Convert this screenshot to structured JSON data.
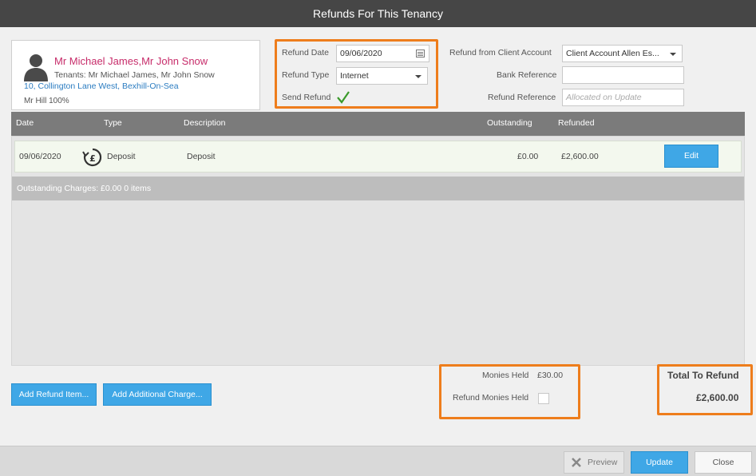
{
  "window": {
    "title": "Refunds For This Tenancy"
  },
  "tenant": {
    "name": "Mr Michael James,Mr John Snow",
    "tenants_line": "Tenants: Mr Michael James, Mr John Snow",
    "address": "10, Collington Lane West, Bexhill-On-Sea",
    "landlord": "Mr Hill 100%"
  },
  "refund_form": {
    "refund_date_label": "Refund Date",
    "refund_date_value": "09/06/2020",
    "refund_type_label": "Refund Type",
    "refund_type_value": "Internet",
    "send_refund_label": "Send Refund",
    "send_refund_checked": true,
    "client_account_label": "Refund from Client Account",
    "client_account_value": "Client Account Allen Es...",
    "bank_reference_label": "Bank Reference",
    "bank_reference_value": "",
    "refund_reference_label": "Refund Reference",
    "refund_reference_placeholder": "Allocated on Update"
  },
  "table": {
    "headers": {
      "date": "Date",
      "type": "Type",
      "description": "Description",
      "outstanding": "Outstanding",
      "refunded": "Refunded"
    },
    "rows": [
      {
        "date": "09/06/2020",
        "type": "Deposit",
        "description": "Deposit",
        "outstanding": "£0.00",
        "refunded": "£2,600.00",
        "action": "Edit"
      }
    ],
    "summary": "Outstanding Charges: £0.00 0 items"
  },
  "actions": {
    "add_refund_item": "Add Refund Item...",
    "add_additional_charge": "Add Additional Charge..."
  },
  "monies": {
    "held_label": "Monies Held",
    "held_value": "£30.00",
    "refund_held_label": "Refund Monies Held",
    "refund_held_checked": false
  },
  "total": {
    "label": "Total To Refund",
    "value": "£2,600.00"
  },
  "footer": {
    "preview": "Preview",
    "update": "Update",
    "close": "Close"
  },
  "colors": {
    "accent_blue": "#3fa7e6",
    "highlight_orange": "#ee7d1c",
    "tenant_name": "#c72c6a",
    "address_link": "#2b7cc1",
    "check_green": "#3a9a2a"
  },
  "icons": {
    "avatar": "person-silhouette-icon",
    "calendar": "calendar-icon",
    "dropdown": "chevron-down-icon",
    "checkmark": "checkmark-icon",
    "refund": "pound-refund-icon",
    "preview": "cross-icon"
  }
}
